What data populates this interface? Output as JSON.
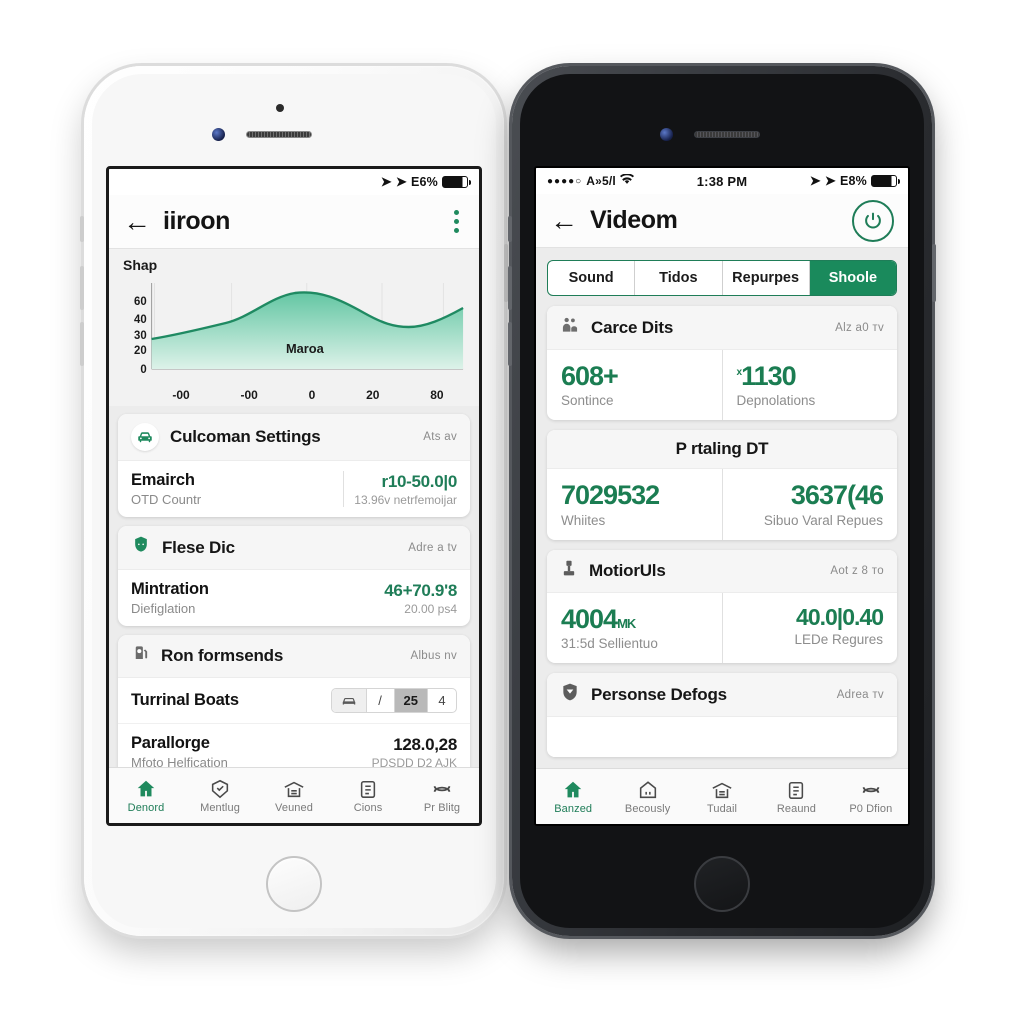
{
  "theme": {
    "accent": "#1f7d58",
    "accent_fill": "#1a8a5c",
    "background": "#ffffff",
    "screen_bg": "#ececec"
  },
  "left_phone": {
    "device": "white-iphone",
    "statusbar": {
      "signal_icon_1": "location-arrow-icon",
      "signal_icon_2": "location-arrow-icon",
      "battery_pct": "E6%",
      "battery_icon": "battery-icon"
    },
    "navbar": {
      "back_icon": "back-arrow-icon",
      "title": "iiroon",
      "menu_icon": "kebab-menu-icon"
    },
    "chart_data": {
      "type": "area",
      "title": "Shap",
      "ylabel": "Shap",
      "xlabel": "",
      "annotation": "Maroa",
      "yticks": [
        "0",
        "20",
        "30",
        "40",
        "60"
      ],
      "xticks": [
        "-00",
        "-00",
        "0",
        "20",
        "80"
      ],
      "ylim": [
        0,
        70
      ],
      "xlim": [
        -60,
        100
      ],
      "grid": true,
      "x": [
        -60,
        -45,
        -30,
        -15,
        0,
        10,
        25,
        40,
        55,
        70,
        82,
        92,
        100
      ],
      "values": [
        30,
        33,
        37,
        41,
        55,
        64,
        63,
        58,
        50,
        43,
        40,
        43,
        51
      ],
      "series": [
        {
          "name": "Maroa",
          "values": [
            30,
            33,
            37,
            41,
            55,
            64,
            63,
            58,
            50,
            43,
            40,
            43,
            51
          ]
        }
      ],
      "line_color": "#1f8a62",
      "fill_top": "#5fc3a0",
      "fill_bottom": "#d9f0e6"
    },
    "cards": [
      {
        "icon": "car-icon",
        "title": "Culcoman Settings",
        "action": "Ats av",
        "rows": [
          {
            "title": "Emairch",
            "sub": "OTD Countr",
            "value": "r10-50.0|0",
            "value_sub": "13.96v netrfemoijar"
          }
        ]
      },
      {
        "icon": "shield-leaf-icon",
        "title": "Flese Dic",
        "action": "Adre a tv",
        "rows": [
          {
            "title": "Mintration",
            "sub": "Diefiglation",
            "value": "46+70.9'8",
            "value_sub": "20.00 ps4"
          }
        ]
      },
      {
        "icon": "gas-pump-icon",
        "title": "Ron formsends",
        "action": "Albus nv",
        "rows": [
          {
            "title": "Turrinal Boats",
            "segmented": {
              "icon": "car-icon",
              "items": [
                "/",
                "25",
                "4"
              ],
              "active_index": 1
            }
          },
          {
            "title": "Parallorge",
            "sub": "Mfoto Helfication",
            "value": "128.0,28",
            "value_sub": "PDSDD D2 AJK"
          }
        ]
      }
    ],
    "tabbar": [
      {
        "icon": "home-icon",
        "label": "Denord",
        "active": true
      },
      {
        "icon": "check-tag-icon",
        "label": "Mentlug",
        "active": false
      },
      {
        "icon": "garage-icon",
        "label": "Veuned",
        "active": false
      },
      {
        "icon": "clipboard-icon",
        "label": "Cions",
        "active": false
      },
      {
        "icon": "sync-icon",
        "label": "Pr Blitg",
        "active": false
      }
    ]
  },
  "right_phone": {
    "device": "black-iphone",
    "statusbar": {
      "dots": "●●●●○",
      "carrier": "A»5/l",
      "wifi_icon": "wifi-icon",
      "time": "1:38 PM",
      "signal_icon_1": "location-arrow-icon",
      "signal_icon_2": "location-arrow-icon",
      "battery_pct": "E8%",
      "battery_icon": "battery-icon"
    },
    "navbar": {
      "back_icon": "back-arrow-icon",
      "title": "Videom",
      "action_icon": "power-refresh-icon"
    },
    "tabs": [
      {
        "label": "Sound",
        "active": false
      },
      {
        "label": "Tidos",
        "active": false
      },
      {
        "label": "Repurpes",
        "active": false
      },
      {
        "label": "Shoole",
        "active": true
      }
    ],
    "cards": [
      {
        "icon": "people-icon",
        "title": "Carce Dits",
        "action": "Alz a0 тv",
        "centered_title": false,
        "stats": [
          {
            "value": "608+",
            "label": "Sontince",
            "sup": ""
          },
          {
            "value": "1130",
            "label": "Depnolations",
            "sup": "x"
          }
        ]
      },
      {
        "icon": "",
        "title": "P rtaling DT",
        "action": "",
        "centered_title": true,
        "stats": [
          {
            "value": "7029532",
            "label": "Whiites",
            "sup": ""
          },
          {
            "value": "3637(46",
            "label": "Sibuo Varal Repues",
            "sup": ""
          }
        ]
      },
      {
        "icon": "pump-icon",
        "title": "MotiorUls",
        "action": "Aot z 8 тo",
        "centered_title": false,
        "stats": [
          {
            "value": "4004",
            "unit": "MK",
            "label": "31:5d Sellientuo",
            "sup": ""
          },
          {
            "value": "40.0|0.40",
            "label": "LEDe Regures",
            "sup": ""
          }
        ]
      },
      {
        "icon": "shield-icon",
        "title": "Personse Defogs",
        "action": "Adrea тv",
        "centered_title": false,
        "stats": []
      }
    ],
    "tabbar": [
      {
        "icon": "home-icon",
        "label": "Banzed",
        "active": true
      },
      {
        "icon": "house-icon",
        "label": "Becously",
        "active": false
      },
      {
        "icon": "garage-icon",
        "label": "Tudail",
        "active": false
      },
      {
        "icon": "clipboard-icon",
        "label": "Reaund",
        "active": false
      },
      {
        "icon": "sync-icon",
        "label": "P0 Dfion",
        "active": false
      }
    ]
  }
}
